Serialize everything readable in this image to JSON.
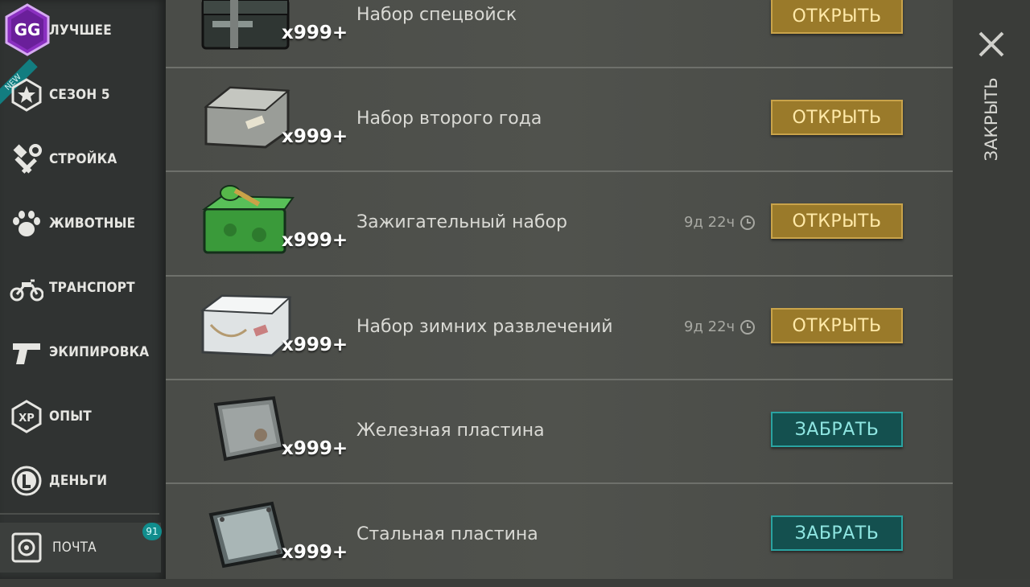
{
  "sidebar": {
    "logo_text": "GG",
    "new_badge": "NEW",
    "items": [
      {
        "label": "ЛУЧШЕЕ",
        "icon": "gg-logo-icon"
      },
      {
        "label": "СЕЗОН 5",
        "icon": "star-badge-icon"
      },
      {
        "label": "СТРОЙКА",
        "icon": "hammer-wrench-icon"
      },
      {
        "label": "ЖИВОТНЫЕ",
        "icon": "paw-icon"
      },
      {
        "label": "ТРАНСПОРТ",
        "icon": "motorcycle-icon"
      },
      {
        "label": "ЭКИПИРОВКА",
        "icon": "pistol-icon"
      },
      {
        "label": "ОПЫТ",
        "icon": "xp-icon"
      },
      {
        "label": "ДЕНЬГИ",
        "icon": "coin-icon"
      }
    ],
    "mail": {
      "label": "ПОЧТА",
      "badge": "91",
      "icon": "mail-safe-icon"
    }
  },
  "items": [
    {
      "name": "Набор спецвойск",
      "qty": "x999+",
      "timer": "",
      "button": "ОТКРЫТЬ",
      "button_type": "open",
      "icon": "military-crate-icon"
    },
    {
      "name": "Набор второго года",
      "qty": "x999+",
      "timer": "",
      "button": "ОТКРЫТЬ",
      "button_type": "open",
      "icon": "metal-crate-icon"
    },
    {
      "name": "Зажигательный набор",
      "qty": "x999+",
      "timer": "9д 22ч",
      "button": "ОТКРЫТЬ",
      "button_type": "open",
      "icon": "green-crate-icon"
    },
    {
      "name": "Набор зимних развлечений",
      "qty": "x999+",
      "timer": "9д 22ч",
      "button": "ОТКРЫТЬ",
      "button_type": "open",
      "icon": "white-crate-icon"
    },
    {
      "name": "Железная пластина",
      "qty": "x999+",
      "timer": "",
      "button": "ЗАБРАТЬ",
      "button_type": "take",
      "icon": "iron-plate-icon"
    },
    {
      "name": "Стальная пластина",
      "qty": "x999+",
      "timer": "",
      "button": "ЗАБРАТЬ",
      "button_type": "take",
      "icon": "steel-plate-icon"
    }
  ],
  "close": {
    "label": "ЗАКРЫТЬ"
  },
  "colors": {
    "open_button": "#9a7a2a",
    "take_button": "#14504f",
    "badge": "#118d8d"
  }
}
